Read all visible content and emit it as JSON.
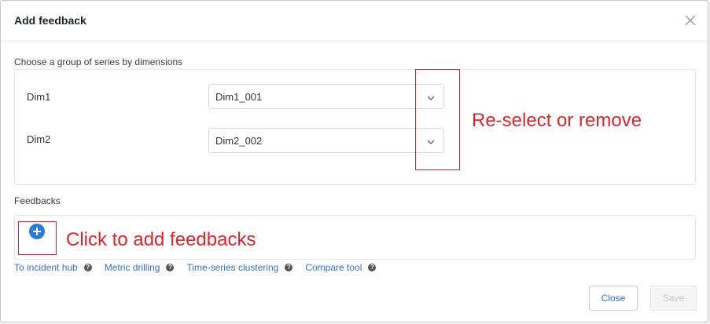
{
  "dialog": {
    "title": "Add feedback"
  },
  "dimensions_section": {
    "label": "Choose a group of series by dimensions",
    "rows": [
      {
        "label": "Dim1",
        "value": "Dim1_001"
      },
      {
        "label": "Dim2",
        "value": "Dim2_002"
      }
    ]
  },
  "feedbacks_section": {
    "label": "Feedbacks"
  },
  "links": [
    {
      "label": "To incident hub"
    },
    {
      "label": "Metric drilling"
    },
    {
      "label": "Time-series clustering"
    },
    {
      "label": "Compare tool"
    }
  ],
  "footer": {
    "close_label": "Close",
    "save_label": "Save"
  },
  "annotations": {
    "reselect": "Re-select or remove",
    "add": "Click to add feedbacks"
  },
  "colors": {
    "accent": "#2f72d2",
    "annotation": "#e0242b",
    "add_icon": "#2b7bd9"
  },
  "icons": {
    "close": "close-icon",
    "chevron": "chevron-down-icon",
    "add": "plus-circle-icon",
    "help": "question-circle-icon"
  }
}
